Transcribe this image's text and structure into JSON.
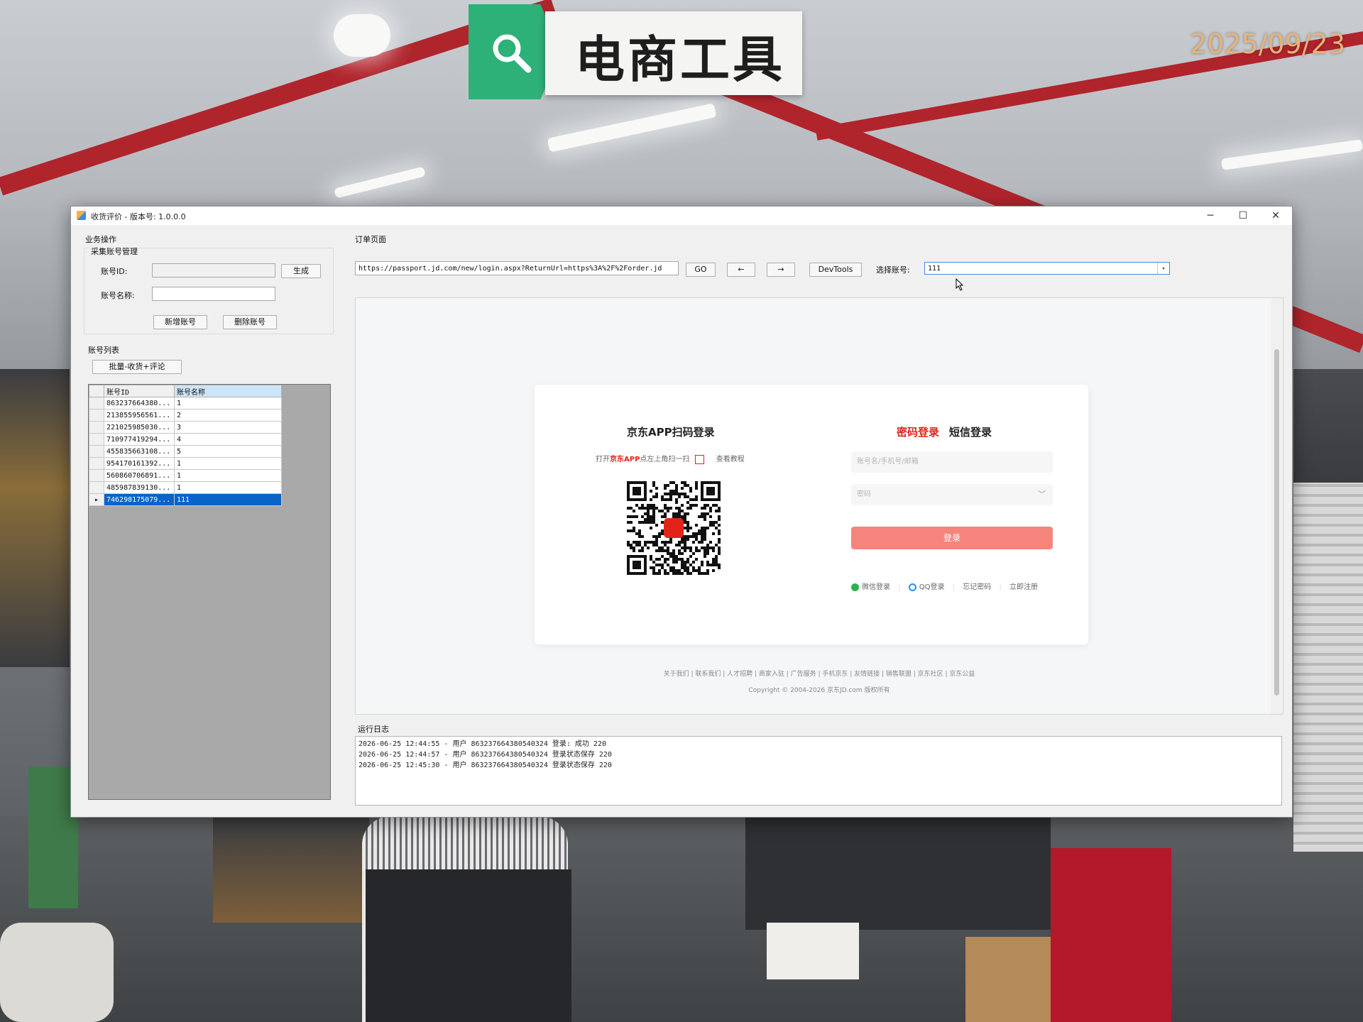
{
  "banner": {
    "title": "电商工具",
    "date": "2025/09/23"
  },
  "window": {
    "title": "收货评价 - 版本号: 1.0.0.0",
    "controls": {
      "minimize": "─",
      "maximize": "☐",
      "close": "✕"
    }
  },
  "left": {
    "section_title": "业务操作",
    "group_title": "采集账号管理",
    "account_id_label": "账号ID:",
    "account_id_value": "",
    "generate_button": "生成",
    "account_name_label": "账号名称:",
    "account_name_value": "",
    "add_button": "新增账号",
    "delete_button": "删除账号",
    "list_title": "账号列表",
    "batch_button": "批量-收货+评论",
    "grid": {
      "headers": [
        "账号ID",
        "账号名称"
      ],
      "rows": [
        {
          "id": "863237664380...",
          "name": "1"
        },
        {
          "id": "213855956561...",
          "name": "2"
        },
        {
          "id": "221025985030...",
          "name": "3"
        },
        {
          "id": "710977419294...",
          "name": "4"
        },
        {
          "id": "455835663108...",
          "name": "5"
        },
        {
          "id": "954170161392...",
          "name": "1"
        },
        {
          "id": "560860706891...",
          "name": "1"
        },
        {
          "id": "485987839130...",
          "name": "1"
        },
        {
          "id": "746298175079...",
          "name": "111"
        }
      ],
      "selected_index": 8
    }
  },
  "right": {
    "section_title": "订单页面",
    "url": "https://passport.jd.com/new/login.aspx?ReturnUrl=https%3A%2F%2Forder.jd",
    "go_button": "GO",
    "back_button": "←",
    "forward_button": "→",
    "devtools_button": "DevTools",
    "account_select_label": "选择账号:",
    "account_select_value": "111",
    "page": {
      "qr_title": "京东APP扫码登录",
      "qr_sub_prefix": "打开",
      "qr_sub_app": "京东APP",
      "qr_sub_suffix": "点左上角扫一扫",
      "qr_help": "查看教程",
      "tab_password": "密码登录",
      "tab_sms": "短信登录",
      "username_placeholder": "账号名/手机号/邮箱",
      "password_placeholder": "密码",
      "login_button": "登录",
      "link_wechat": "微信登录",
      "link_qq": "QQ登录",
      "link_forgot": "忘记密码",
      "link_register": "立即注册",
      "footer_links": "关于我们 | 联系我们 | 人才招聘 | 商家入驻 | 广告服务 | 手机京东 | 友情链接 | 销售联盟 | 京东社区 | 京东公益",
      "copyright": "Copyright © 2004-2026 京东JD.com 版权所有"
    },
    "log_title": "运行日志",
    "log_lines": [
      "2026-06-25 12:44:55 - 用户 863237664380540324 登录: 成功 220",
      "2026-06-25 12:44:57 - 用户 863237664380540324 登录状态保存 220",
      "2026-06-25 12:45:30 - 用户 863237664380540324 登录状态保存 220"
    ]
  },
  "colors": {
    "accent_red": "#e2231a",
    "login_button": "#f5847c",
    "grid_select": "#0a63c9",
    "banner_green": "#2eb079"
  }
}
